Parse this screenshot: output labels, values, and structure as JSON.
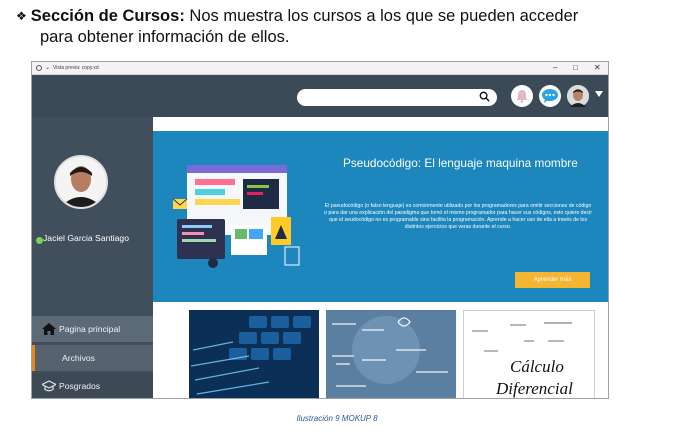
{
  "doc": {
    "bullet": "❖",
    "heading_bold": "Sección de Cursos:",
    "heading_rest": " Nos muestra los cursos a los que se pueden acceder",
    "heading_line2": "para obtener información de ellos.",
    "caption": "Ilustración 9 MOKUP 8"
  },
  "window": {
    "title": "Vista previa: copy.xd",
    "controls": [
      "–",
      "□",
      "✕"
    ]
  },
  "user": {
    "name": "Jaciel Garcia Santiago"
  },
  "nav": {
    "home": "Pagina principal",
    "files": "Archivos",
    "postgrad": "Posgrados"
  },
  "hero": {
    "title": "Pseudocódigo: El lenguaje maquina mombre",
    "text": "El pseudocódigo (o falso lenguaje) es comúnmente utilizado por los programadores para omitir secciones de código o para dar una explicación del paradigma que tomó el mismo programador para hacer sus códigos, esto quiere decir que el seudocódigo no es programable sino facilita la programación. Aprende a hacer uso de ella a través de los distintos ejercicios que veras durante el curso.",
    "button": "Aprender más"
  },
  "cards": {
    "calc_line1": "Cálculo",
    "calc_line2": "Diferencial"
  },
  "colors": {
    "topbar": "#3c4a58",
    "sidebar": "#414e5c",
    "hero_blue": "#1c86bd",
    "button": "#f4b532",
    "accent": "#e58a1f"
  }
}
